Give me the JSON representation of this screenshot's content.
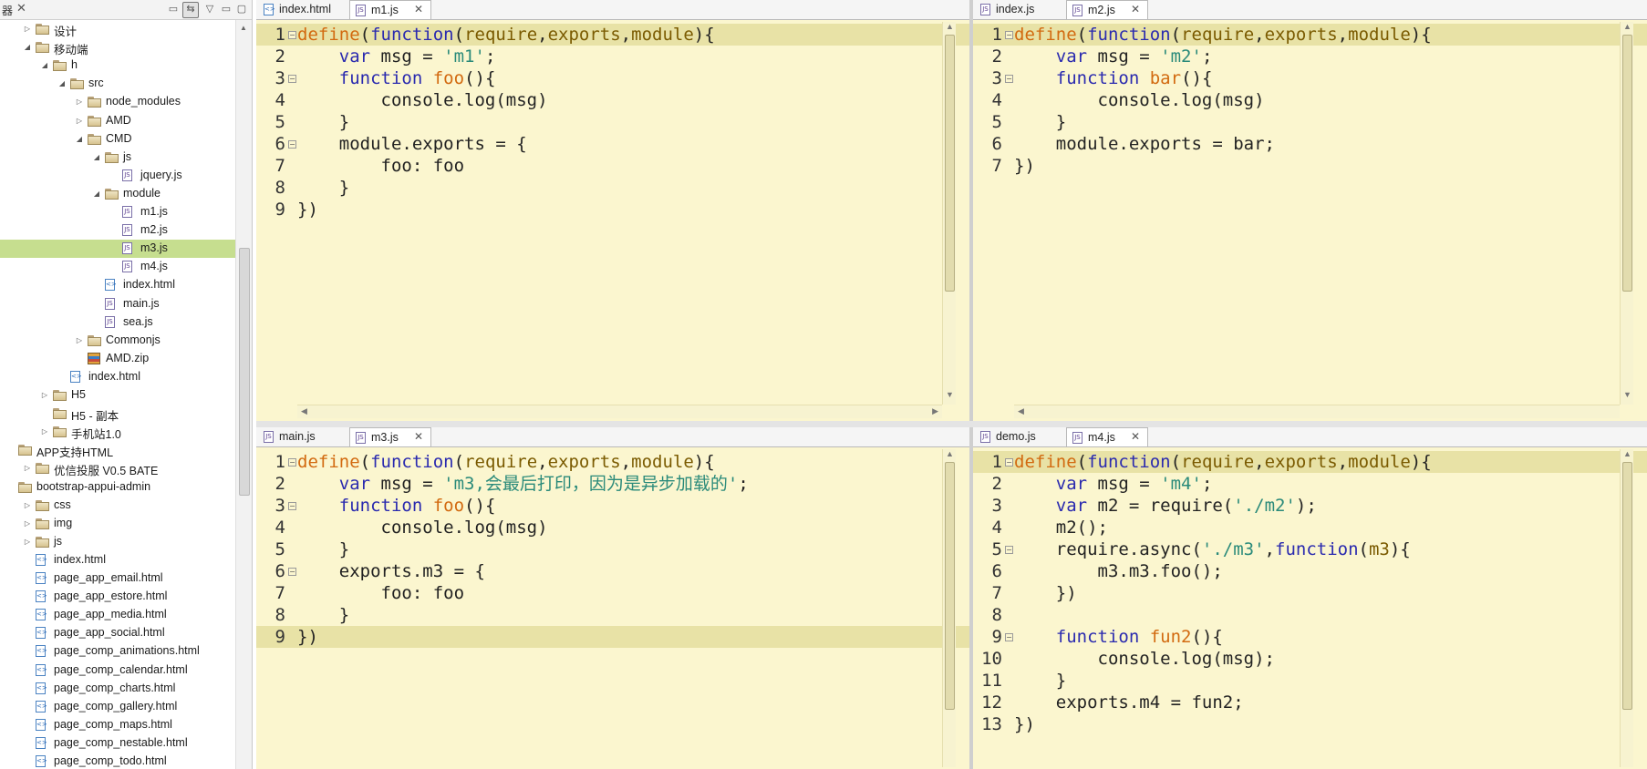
{
  "sidebar": {
    "title": "器",
    "toolbar": {
      "collapse": "▭",
      "link": "⇆",
      "menu": "▽",
      "minimize": "▭",
      "maximize": "▢"
    },
    "tree": [
      {
        "label": "设计",
        "type": "folder",
        "depth": 1,
        "expanded": false
      },
      {
        "label": "移动端",
        "type": "folder",
        "depth": 1,
        "expanded": true
      },
      {
        "label": "h",
        "type": "folder",
        "depth": 2,
        "expanded": true
      },
      {
        "label": "src",
        "type": "folder",
        "depth": 3,
        "expanded": true
      },
      {
        "label": "node_modules",
        "type": "folder",
        "depth": 4,
        "expanded": false
      },
      {
        "label": "AMD",
        "type": "folder",
        "depth": 4,
        "expanded": false
      },
      {
        "label": "CMD",
        "type": "folder",
        "depth": 4,
        "expanded": true
      },
      {
        "label": "js",
        "type": "folder",
        "depth": 5,
        "expanded": true
      },
      {
        "label": "jquery.js",
        "type": "js",
        "depth": 6
      },
      {
        "label": "module",
        "type": "folder",
        "depth": 5,
        "expanded": true
      },
      {
        "label": "m1.js",
        "type": "js",
        "depth": 6
      },
      {
        "label": "m2.js",
        "type": "js",
        "depth": 6
      },
      {
        "label": "m3.js",
        "type": "js",
        "depth": 6,
        "selected": true
      },
      {
        "label": "m4.js",
        "type": "js",
        "depth": 6
      },
      {
        "label": "index.html",
        "type": "html",
        "depth": 5
      },
      {
        "label": "main.js",
        "type": "js",
        "depth": 5
      },
      {
        "label": "sea.js",
        "type": "js",
        "depth": 5
      },
      {
        "label": "Commonjs",
        "type": "folder",
        "depth": 4,
        "expanded": false
      },
      {
        "label": "AMD.zip",
        "type": "zip",
        "depth": 4
      },
      {
        "label": "index.html",
        "type": "html",
        "depth": 3
      },
      {
        "label": "H5",
        "type": "folder",
        "depth": 2,
        "expanded": false
      },
      {
        "label": "H5 - 副本",
        "type": "folder",
        "depth": 2
      },
      {
        "label": "手机站1.0",
        "type": "folder",
        "depth": 2,
        "expanded": false
      },
      {
        "label": "APP支持HTML",
        "type": "folder",
        "depth": 0
      },
      {
        "label": "优信投服 V0.5 BATE",
        "type": "folder",
        "depth": 1,
        "expanded": false
      },
      {
        "label": "bootstrap-appui-admin",
        "type": "folder",
        "depth": 0
      },
      {
        "label": "css",
        "type": "folder",
        "depth": 1,
        "expanded": false
      },
      {
        "label": "img",
        "type": "folder",
        "depth": 1,
        "expanded": false
      },
      {
        "label": "js",
        "type": "folder",
        "depth": 1,
        "expanded": false
      },
      {
        "label": "index.html",
        "type": "html",
        "depth": 1
      },
      {
        "label": "page_app_email.html",
        "type": "html",
        "depth": 1
      },
      {
        "label": "page_app_estore.html",
        "type": "html",
        "depth": 1
      },
      {
        "label": "page_app_media.html",
        "type": "html",
        "depth": 1
      },
      {
        "label": "page_app_social.html",
        "type": "html",
        "depth": 1
      },
      {
        "label": "page_comp_animations.html",
        "type": "html",
        "depth": 1
      },
      {
        "label": "page_comp_calendar.html",
        "type": "html",
        "depth": 1
      },
      {
        "label": "page_comp_charts.html",
        "type": "html",
        "depth": 1
      },
      {
        "label": "page_comp_gallery.html",
        "type": "html",
        "depth": 1
      },
      {
        "label": "page_comp_maps.html",
        "type": "html",
        "depth": 1
      },
      {
        "label": "page_comp_nestable.html",
        "type": "html",
        "depth": 1
      },
      {
        "label": "page_comp_todo.html",
        "type": "html",
        "depth": 1
      }
    ]
  },
  "panes": [
    {
      "id": "top-left",
      "tabs": [
        {
          "label": "index.html",
          "type": "html",
          "active": false
        },
        {
          "label": "m1.js",
          "type": "js",
          "active": true,
          "closable": true
        }
      ],
      "lines": [
        {
          "n": "1",
          "fold": true,
          "hl": true,
          "html": "<span class=\"d\">define</span>(<span class=\"k\">function</span>(<span class=\"p\">require</span>,<span class=\"p\">exports</span>,<span class=\"p\">module</span>){"
        },
        {
          "n": "2",
          "html": "    <span class=\"k\">var</span> msg = <span class=\"s\">'m1'</span>;"
        },
        {
          "n": "3",
          "fold": true,
          "html": "    <span class=\"k\">function</span> <span class=\"f\">foo</span>(){"
        },
        {
          "n": "4",
          "html": "        console.log(msg)"
        },
        {
          "n": "5",
          "html": "    }"
        },
        {
          "n": "6",
          "fold": true,
          "html": "    module.exports = {"
        },
        {
          "n": "7",
          "html": "        foo: foo"
        },
        {
          "n": "8",
          "html": "    }"
        },
        {
          "n": "9",
          "html": "})"
        }
      ]
    },
    {
      "id": "top-right",
      "tabs": [
        {
          "label": "index.js",
          "type": "js",
          "active": false
        },
        {
          "label": "m2.js",
          "type": "js",
          "active": true,
          "closable": true
        }
      ],
      "lines": [
        {
          "n": "1",
          "fold": true,
          "hl": true,
          "html": "<span class=\"d\">define</span>(<span class=\"k\">function</span>(<span class=\"p\">require</span>,<span class=\"p\">exports</span>,<span class=\"p\">module</span>){"
        },
        {
          "n": "2",
          "html": "    <span class=\"k\">var</span> msg = <span class=\"s\">'m2'</span>;"
        },
        {
          "n": "3",
          "fold": true,
          "html": "    <span class=\"k\">function</span> <span class=\"f\">bar</span>(){"
        },
        {
          "n": "4",
          "html": "        console.log(msg)"
        },
        {
          "n": "5",
          "html": "    }"
        },
        {
          "n": "6",
          "html": "    module.exports = bar;"
        },
        {
          "n": "7",
          "html": "})"
        }
      ]
    },
    {
      "id": "bottom-left",
      "tabs": [
        {
          "label": "main.js",
          "type": "js",
          "active": false
        },
        {
          "label": "m3.js",
          "type": "js",
          "active": true,
          "closable": true
        }
      ],
      "lines": [
        {
          "n": "1",
          "fold": true,
          "html": "<span class=\"d\">define</span>(<span class=\"k\">function</span>(<span class=\"p\">require</span>,<span class=\"p\">exports</span>,<span class=\"p\">module</span>){"
        },
        {
          "n": "2",
          "html": "    <span class=\"k\">var</span> msg = <span class=\"s\">'m3,会最后打印，因为是异步加载的'</span>;"
        },
        {
          "n": "3",
          "fold": true,
          "html": "    <span class=\"k\">function</span> <span class=\"f\">foo</span>(){"
        },
        {
          "n": "4",
          "html": "        console.log(msg)"
        },
        {
          "n": "5",
          "html": "    }"
        },
        {
          "n": "6",
          "fold": true,
          "html": "    exports.m3 = {"
        },
        {
          "n": "7",
          "html": "        foo: foo"
        },
        {
          "n": "8",
          "html": "    }"
        },
        {
          "n": "9",
          "hl": true,
          "html": "})"
        }
      ]
    },
    {
      "id": "bottom-right",
      "tabs": [
        {
          "label": "demo.js",
          "type": "js",
          "active": false
        },
        {
          "label": "m4.js",
          "type": "js",
          "active": true,
          "closable": true
        }
      ],
      "lines": [
        {
          "n": "1",
          "fold": true,
          "hl": true,
          "html": "<span class=\"d\">define</span>(<span class=\"k\">function</span>(<span class=\"p\">require</span>,<span class=\"p\">exports</span>,<span class=\"p\">module</span>){"
        },
        {
          "n": "2",
          "html": "    <span class=\"k\">var</span> msg = <span class=\"s\">'m4'</span>;"
        },
        {
          "n": "3",
          "html": "    <span class=\"k\">var</span> m2 = require(<span class=\"s\">'./m2'</span>);"
        },
        {
          "n": "4",
          "html": "    m2();"
        },
        {
          "n": "5",
          "fold": true,
          "html": "    require.async(<span class=\"s\">'./m3'</span>,<span class=\"k\">function</span>(<span class=\"p\">m3</span>){"
        },
        {
          "n": "6",
          "html": "        m3.m3.foo();"
        },
        {
          "n": "7",
          "html": "    })"
        },
        {
          "n": "8",
          "html": ""
        },
        {
          "n": "9",
          "fold": true,
          "html": "    <span class=\"k\">function</span> <span class=\"f\">fun2</span>(){"
        },
        {
          "n": "10",
          "html": "        console.log(msg);"
        },
        {
          "n": "11",
          "html": "    }"
        },
        {
          "n": "12",
          "html": "    exports.m4 = fun2;"
        },
        {
          "n": "13",
          "html": "})"
        }
      ]
    }
  ]
}
